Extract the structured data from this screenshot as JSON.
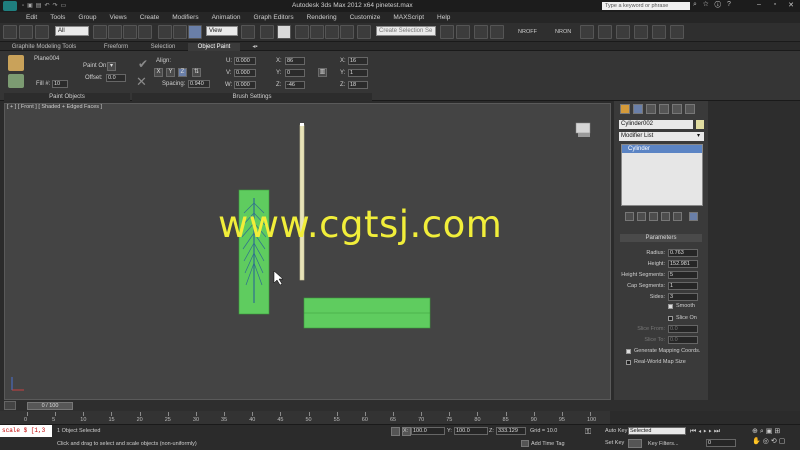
{
  "app": {
    "title": "Autodesk 3ds Max  2012 x64      pinetest.max",
    "search_placeholder": "Type a keyword or phrase"
  },
  "menu": [
    "Edit",
    "Tools",
    "Group",
    "Views",
    "Create",
    "Modifiers",
    "Animation",
    "Graph Editors",
    "Rendering",
    "Customize",
    "MAXScript",
    "Help"
  ],
  "toolbar": {
    "filter_value": "All",
    "ref_coord_value": "View",
    "selection_set_placeholder": "Create Selection Se",
    "nrop_label": "NROFF",
    "nron_label": "NRON"
  },
  "ribbon_tabs": [
    "Graphite Modeling Tools",
    "Freeform",
    "Selection",
    "Object Paint"
  ],
  "ribbon": {
    "object_name": "Plane004",
    "paint_on_label": "Paint On:",
    "offset_label": "Offset:",
    "offset_value": "0.0",
    "fill_label": "Fill #:",
    "fill_value": "10",
    "align_label": "Align:",
    "axes": [
      "X",
      "Y",
      "Z"
    ],
    "spacing_label": "Spacing:",
    "spacing_value": "0.940",
    "u_label": "U:",
    "u_value": "0.000",
    "v_label": "V:",
    "v_value": "0.000",
    "w_label": "W:",
    "w_value": "0.000",
    "x_label": "X:",
    "x_value": "86",
    "y_label": "Y:",
    "y_value": "0",
    "z_label": "Z:",
    "z_value": "-46",
    "x2_label": "X:",
    "x2_value": "16",
    "y2_label": "Y:",
    "y2_value": "1",
    "z2_label": "Z:",
    "z2_value": "18",
    "group_paint_objects": "Paint Objects",
    "group_brush_settings": "Brush Settings"
  },
  "viewport": {
    "label": "[ + ] [ Front ] [ Shaded + Edged Faces ]"
  },
  "command_panel": {
    "object_name": "Cylinder002",
    "object_color": "#e0dca0",
    "modifier_list": "Modifier List",
    "stack_items": [
      "Cylinder"
    ],
    "params_header": "Parameters",
    "params": [
      {
        "label": "Radius:",
        "value": "0.763"
      },
      {
        "label": "Height:",
        "value": "152.981"
      },
      {
        "label": "Height Segments:",
        "value": "5"
      },
      {
        "label": "Cap Segments:",
        "value": "1"
      },
      {
        "label": "Sides:",
        "value": "3"
      }
    ],
    "smooth_label": "Smooth",
    "slice_on_label": "Slice On",
    "slice_from_label": "Slice From:",
    "slice_from_value": "0.0",
    "slice_to_label": "Slice To:",
    "slice_to_value": "0.0",
    "gen_mapping_label": "Generate Mapping Coords.",
    "real_world_label": "Real-World Map Size"
  },
  "timeline": {
    "slider": "0 / 100",
    "ticks": [
      "0",
      "5",
      "10",
      "15",
      "20",
      "25",
      "30",
      "35",
      "40",
      "45",
      "50",
      "55",
      "60",
      "65",
      "70",
      "75",
      "80",
      "85",
      "90",
      "95",
      "100"
    ]
  },
  "status": {
    "maxscript": "scale $ [1,3",
    "selected": "1 Object Selected",
    "prompt": "Click and drag to select and scale objects (non-uniformly)",
    "x_label": "X:",
    "x_value": "100.0",
    "y_label": "Y:",
    "y_value": "100.0",
    "z_label": "Z:",
    "z_value": "333.129",
    "grid": "Grid = 10.0",
    "add_time_tag": "Add Time Tag",
    "auto_key": "Auto Key",
    "auto_key_value": "Selected",
    "set_key": "Set Key",
    "key_filters": "Key Filters...",
    "frame_value": "0"
  },
  "watermark": "www.cgtsj.com",
  "colors": {
    "plane_green": "#5fcc5f",
    "cylinder": "#e8e3b8",
    "watermark": "#f1ee3a"
  }
}
